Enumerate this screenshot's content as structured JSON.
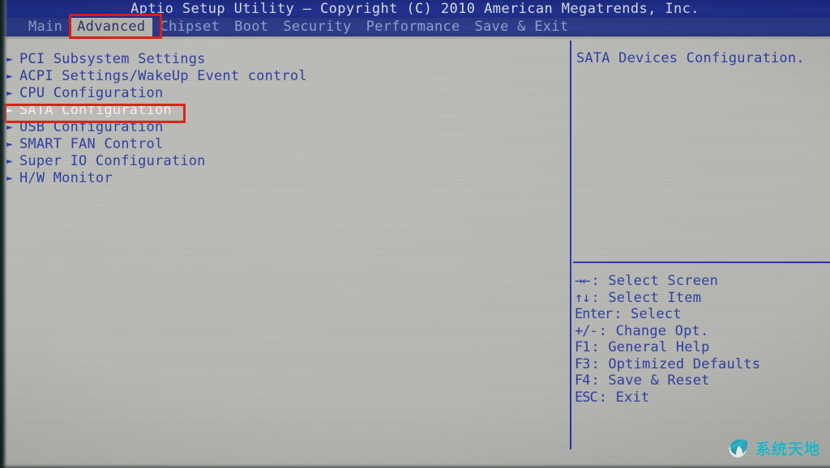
{
  "titlebar": {
    "text": "Aptio Setup Utility – Copyright (C) 2010 American Megatrends, Inc."
  },
  "menubar": {
    "tabs": [
      {
        "label": "Main",
        "active": false
      },
      {
        "label": "Advanced",
        "active": true
      },
      {
        "label": "Chipset",
        "active": false
      },
      {
        "label": "Boot",
        "active": false
      },
      {
        "label": "Security",
        "active": false
      },
      {
        "label": "Performance",
        "active": false
      },
      {
        "label": "Save & Exit",
        "active": false
      }
    ]
  },
  "left_pane": {
    "items": [
      {
        "label": "PCI Subsystem Settings",
        "arrow": "submenu-arrow-icon",
        "selected": false
      },
      {
        "label": "ACPI Settings/WakeUp Event control",
        "arrow": "submenu-arrow-icon",
        "selected": false
      },
      {
        "label": "CPU Configuration",
        "arrow": "submenu-arrow-icon",
        "selected": false
      },
      {
        "label": "SATA Configuration",
        "arrow": "submenu-arrow-icon",
        "selected": true
      },
      {
        "label": "USB Configuration",
        "arrow": "submenu-arrow-icon",
        "selected": false
      },
      {
        "label": "SMART FAN Control",
        "arrow": "submenu-arrow-icon",
        "selected": false
      },
      {
        "label": "Super IO Configuration",
        "arrow": "submenu-arrow-icon",
        "selected": false
      },
      {
        "label": "H/W Monitor",
        "arrow": "submenu-arrow-icon",
        "selected": false
      }
    ]
  },
  "right_pane": {
    "help_text": "SATA Devices Configuration.",
    "key_legend": [
      {
        "keys": "→←",
        "label": ": Select Screen"
      },
      {
        "keys": "↑↓",
        "label": ": Select Item"
      },
      {
        "keys": "Enter",
        "label": ": Select"
      },
      {
        "keys": "+/-",
        "label": ": Change Opt."
      },
      {
        "keys": "F1",
        "label": ": General Help"
      },
      {
        "keys": "F3",
        "label": ": Optimized Defaults"
      },
      {
        "keys": "F4",
        "label": ": Save & Reset"
      },
      {
        "keys": "ESC",
        "label": ": Exit"
      }
    ]
  },
  "annotations": [
    {
      "name": "advanced-tab-highlight",
      "color": "#e01b10"
    },
    {
      "name": "sata-configuration-highlight",
      "color": "#e01b10"
    }
  ],
  "watermark": {
    "text": "系统天地",
    "color": "#17c4d6",
    "logo": "sphere-logo-icon"
  },
  "colors": {
    "title_bar": "#1b2a86",
    "menu_bar": "#27357f",
    "panel_background": "#b9b9b6",
    "text_blue": "#2a3ba0",
    "selected_text": "#f2f2ef",
    "divider": "#2430a4",
    "annotation_red": "#e01b10",
    "active_tab_background": "#b6b5ad"
  }
}
